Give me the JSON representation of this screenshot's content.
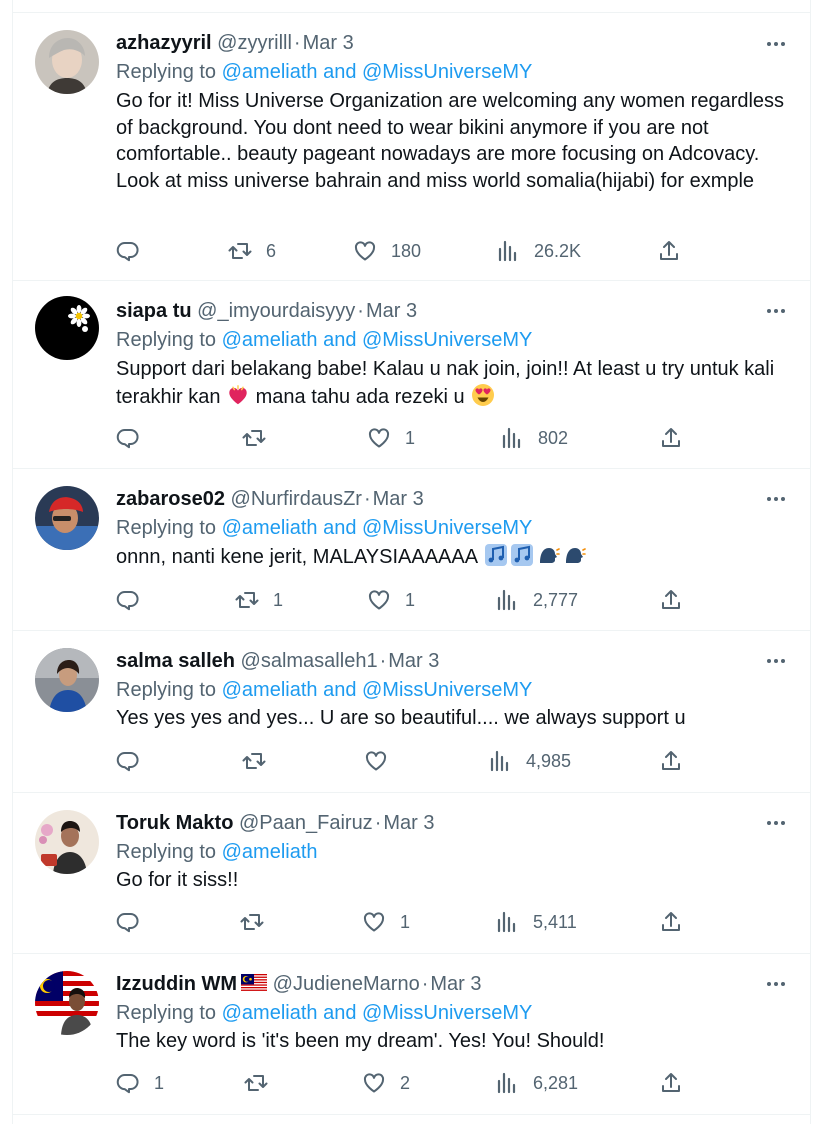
{
  "feed": {
    "tweets": [
      {
        "name": "azhazyyril",
        "handle": "@zyyrilll",
        "date": "Mar 3",
        "replying_prefix": "Replying to",
        "replying_to": "@ameliath and @MissUniverseMY",
        "text": "Go for it! Miss Universe Organization are welcoming any women regardless of background. You dont need to wear bikini anymore if you are not comfortable.. beauty pageant nowadays are more focusing on Adcovacy. Look at miss universe bahrain and miss world somalia(hijabi) for exmple",
        "replies": "",
        "retweets": "6",
        "likes": "180",
        "views": "26.2K"
      },
      {
        "name": "siapa tu",
        "handle": "@_imyourdaisyyy",
        "date": "Mar 3",
        "replying_prefix": "Replying to",
        "replying_to": "@ameliath and @MissUniverseMY",
        "text_1": "Support dari belakang babe! Kalau u nak join, join!! At least u try untuk kali terakhir kan",
        "text_2": "mana tahu ada rezeki u",
        "replies": "",
        "retweets": "",
        "likes": "1",
        "views": "802"
      },
      {
        "name": "zabarose02",
        "handle": "@NurfirdausZr",
        "date": "Mar 3",
        "replying_prefix": "Replying to",
        "replying_to": "@ameliath and @MissUniverseMY",
        "text": "onnn, nanti kene jerit, MALAYSIAAAAAA",
        "replies": "",
        "retweets": "1",
        "likes": "1",
        "views": "2,777"
      },
      {
        "name": "salma salleh",
        "handle": "@salmasalleh1",
        "date": "Mar 3",
        "replying_prefix": "Replying to",
        "replying_to": "@ameliath and @MissUniverseMY",
        "text": "Yes yes yes and yes... U are  so beautiful.... we always support u",
        "replies": "",
        "retweets": "",
        "likes": "",
        "views": "4,985"
      },
      {
        "name": "Toruk Makto",
        "handle": "@Paan_Fairuz",
        "date": "Mar 3",
        "replying_prefix": "Replying to",
        "replying_to": "@ameliath",
        "text": "Go for it siss!!",
        "replies": "",
        "retweets": "",
        "likes": "1",
        "views": "5,411"
      },
      {
        "name": "Izzuddin WM",
        "handle": "@JudieneMarno",
        "date": "Mar 3",
        "replying_prefix": "Replying to",
        "replying_to": "@ameliath and @MissUniverseMY",
        "text": "The key word is 'it's been my dream'. Yes! You! Should!",
        "replies": "1",
        "retweets": "",
        "likes": "2",
        "views": "6,281"
      }
    ]
  },
  "icons": {
    "more": "more-horizontal-icon",
    "reply": "reply-icon",
    "retweet": "retweet-icon",
    "like": "heart-icon",
    "views": "views-icon",
    "share": "share-icon"
  },
  "colors": {
    "text": "#0f1419",
    "secondary": "#536471",
    "mention": "#1d9bf0",
    "divider": "#eff3f4"
  }
}
